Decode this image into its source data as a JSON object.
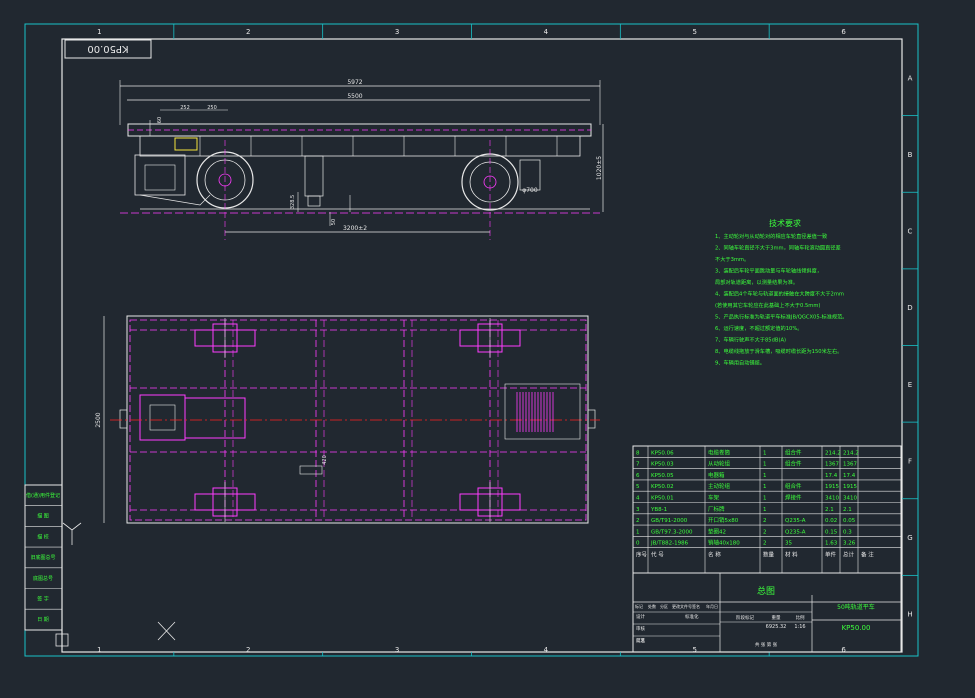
{
  "drawing": {
    "number_stamp": "KP50.00",
    "grid_columns": [
      "1",
      "2",
      "3",
      "4",
      "5",
      "6"
    ],
    "grid_rows": [
      "A",
      "B",
      "C",
      "D",
      "E",
      "F",
      "G",
      "H"
    ]
  },
  "dimensions": {
    "overall_length": "5972",
    "frame_length": "5500",
    "dim_a": "252",
    "dim_b": "250",
    "dim_c": "60",
    "height": "1020±5",
    "wheel_dia": "φ700",
    "dim_d": "328.5",
    "dim_e": "50",
    "wheelbase": "3200±2",
    "width": "2500",
    "dim_f": "420"
  },
  "tech_requirements": {
    "title": "技术要求",
    "items": [
      "1、主动轮对与从动轮对的相应车轮直径差值一致",
      "2、同轴车轮直径不大于3mm，同轴车轮滚动圆直径差",
      "   不大于3mm。",
      "3、装配后车轮平面跳动量与车轮轴线倾斜度，",
      "   局部对轨道距离，以测量结果为准。",
      "4、装配后4个车轮与轨道面的接触在大跨度不大于2mm",
      "   (若使用其它车轮应在此基础上不大于0.5mm)",
      "5、产品执行标准为轨道平车标准JB/QGCX05-标准规范。",
      "6、运行速度，不超过额定值的10%。",
      "7、车辆行驶声不大于85dB(A)",
      "8、电缆线拖放于滑车槽，吸缆时缆长距为150米左右。",
      "9、车辆用自动铺缆。"
    ]
  },
  "bom": {
    "rows": [
      {
        "no": "8",
        "code": "KP50.06",
        "name": "电缆卷筒",
        "qty": "1",
        "mat": "组合件",
        "w1": "214.2",
        "w2": "214.2"
      },
      {
        "no": "7",
        "code": "KP50.03",
        "name": "从动轮组",
        "qty": "1",
        "mat": "组合件",
        "w1": "1367",
        "w2": "1367"
      },
      {
        "no": "6",
        "code": "KP50.05",
        "name": "电器箱",
        "qty": "1",
        "mat": "",
        "w1": "17.4",
        "w2": "17.4"
      },
      {
        "no": "5",
        "code": "KP50.02",
        "name": "主动轮组",
        "qty": "1",
        "mat": "组合件",
        "w1": "1915",
        "w2": "1915"
      },
      {
        "no": "4",
        "code": "KP50.01",
        "name": "车架",
        "qty": "1",
        "mat": "焊接件",
        "w1": "3410",
        "w2": "3410"
      },
      {
        "no": "3",
        "code": "YB8-1",
        "name": "厂标牌",
        "qty": "1",
        "mat": "",
        "w1": "2.1",
        "w2": "2.1"
      },
      {
        "no": "2",
        "code": "GB/T91-2000",
        "name": "开口销5x80",
        "qty": "2",
        "mat": "Q235-A",
        "w1": "0.02",
        "w2": "0.05"
      },
      {
        "no": "1",
        "code": "GB/T97.3-2000",
        "name": "垫圈42",
        "qty": "2",
        "mat": "Q235-A",
        "w1": "0.15",
        "w2": "0.3"
      },
      {
        "no": "0",
        "code": "JB/T882-1986",
        "name": "销轴40x180",
        "qty": "2",
        "mat": "35",
        "w1": "1.63",
        "w2": "3.26"
      }
    ],
    "header": [
      "序号",
      "代 号",
      "名 称",
      "数量",
      "材 料",
      "单件",
      "总计",
      "备 注"
    ]
  },
  "title_block": {
    "assembly": "总图",
    "product": "50吨轨道平车",
    "drawing_no": "KP50.00",
    "weight": "6925.32",
    "scale": "1:16",
    "scale_label": "比例",
    "weight_label": "重量",
    "stage_label": "阶段标记",
    "sheet_label": "共 张 第 张",
    "designer": "设计",
    "checker": "审核",
    "process": "工艺",
    "approve": "批准",
    "mark": "标记",
    "count": "处数",
    "zone": "分区",
    "change_no": "更改文件号",
    "sign": "签名",
    "date": "年月日",
    "std": "标准化"
  },
  "side_register": [
    "借(通)用件登记",
    "描 图",
    "描 校",
    "旧底图总号",
    "底图总号",
    "签 字",
    "日 期"
  ]
}
